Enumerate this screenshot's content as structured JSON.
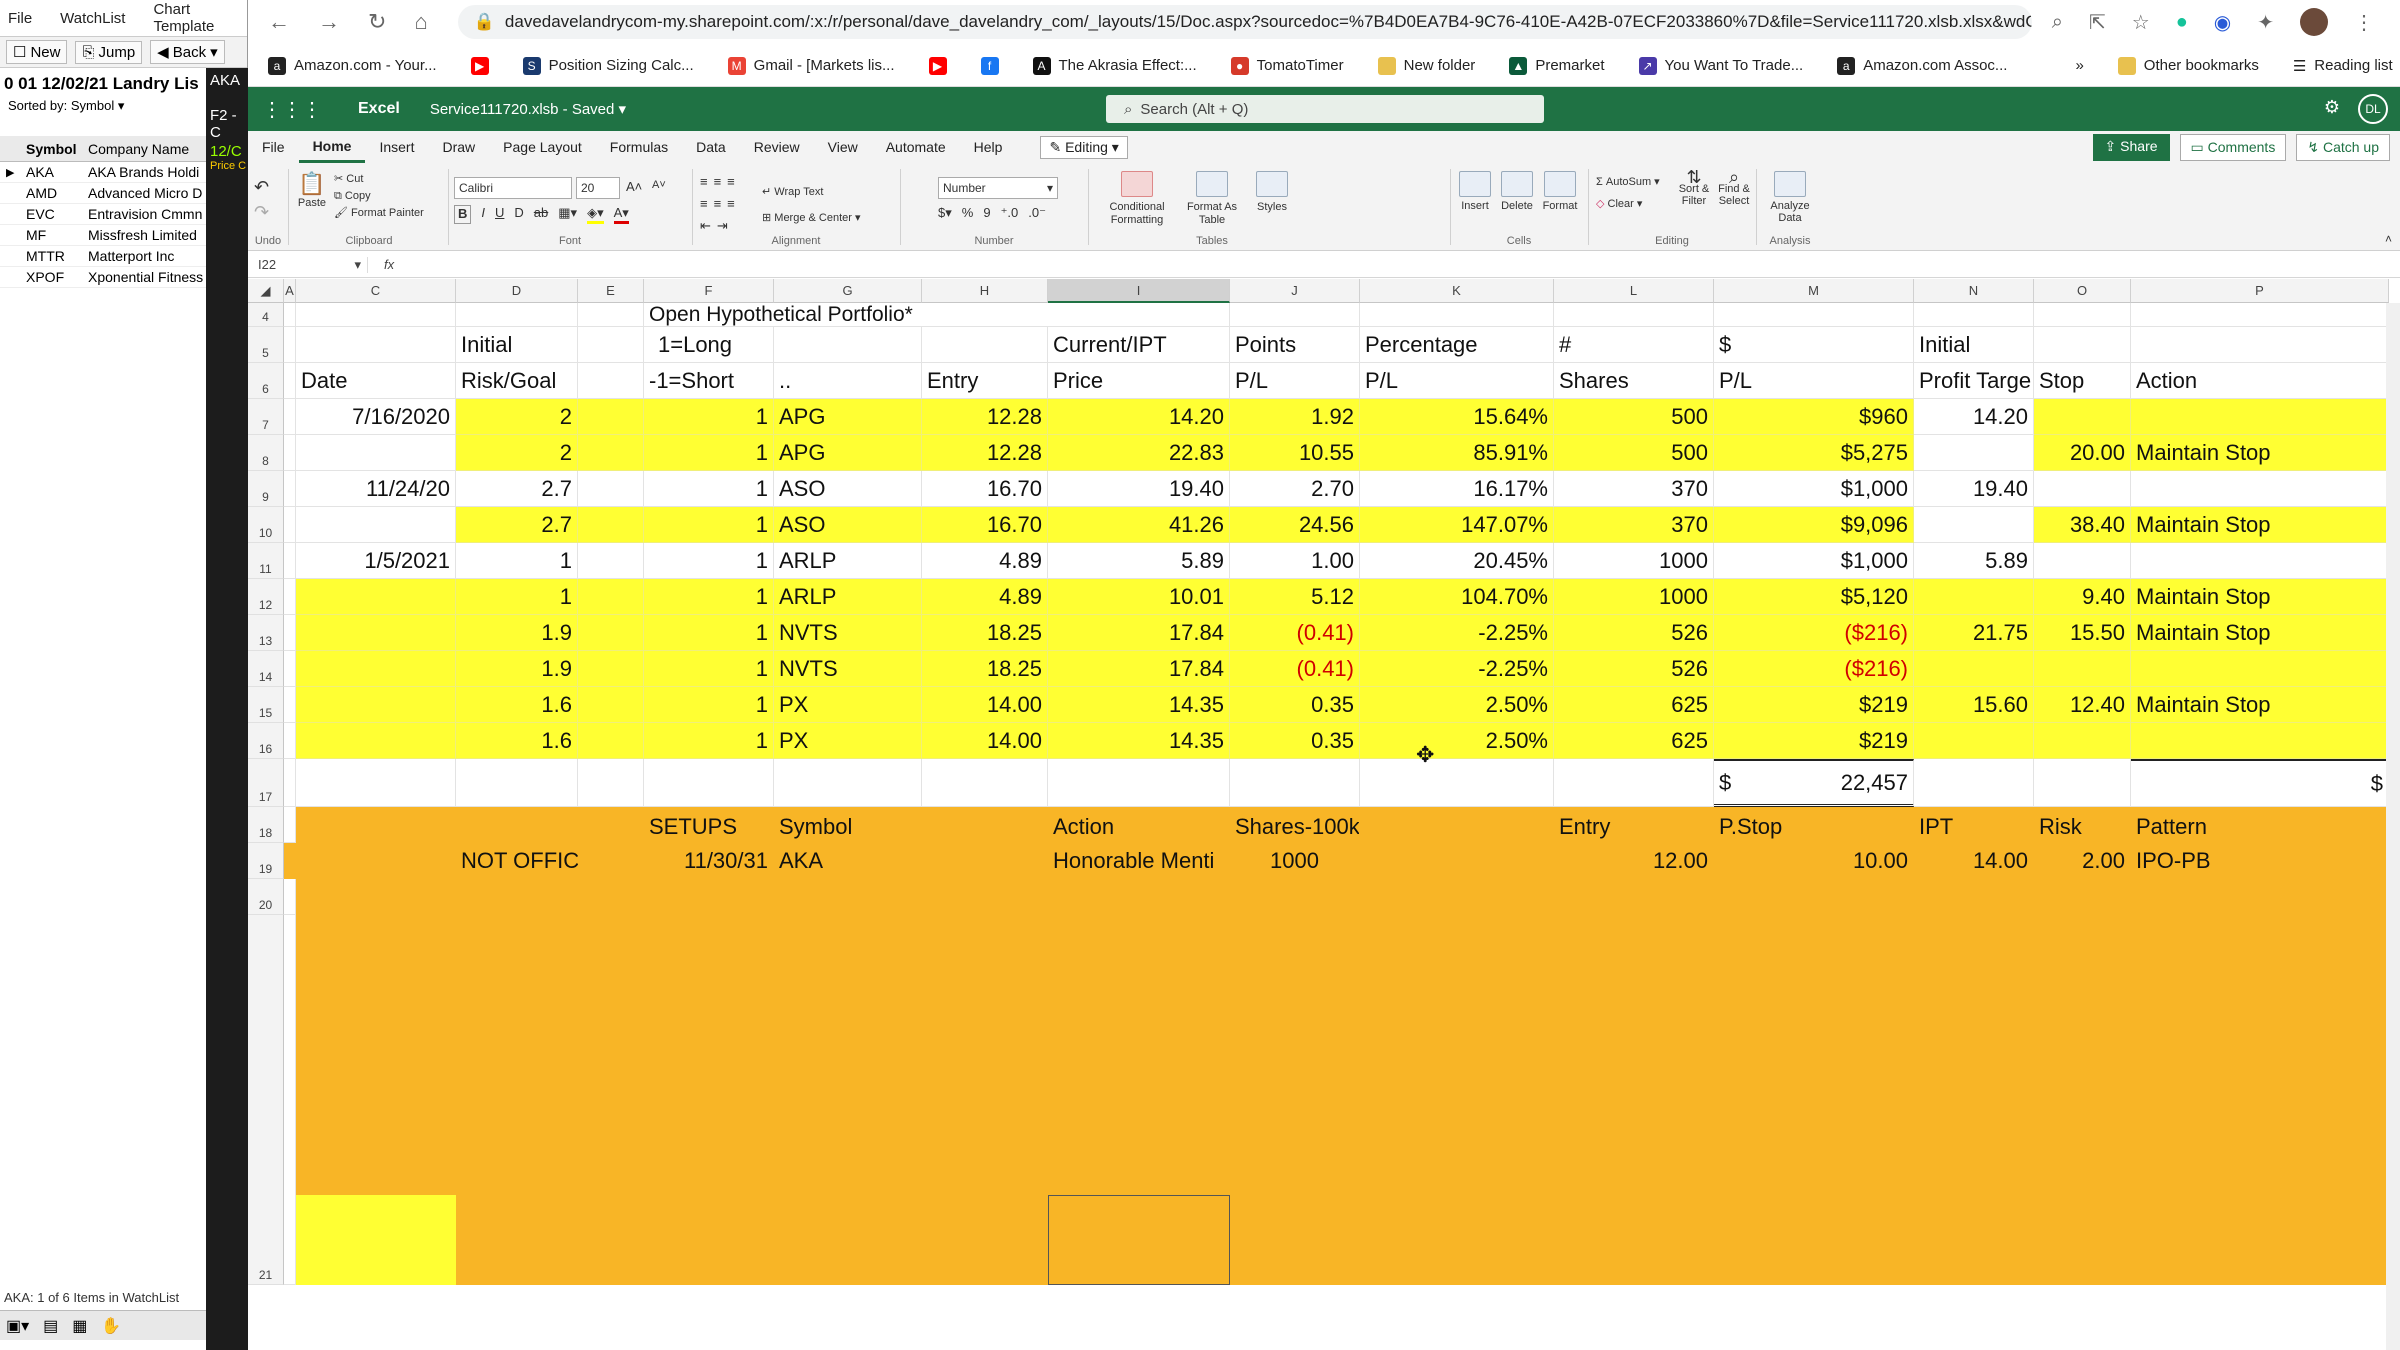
{
  "left_app": {
    "menu": [
      "File",
      "WatchList",
      "Chart Template"
    ],
    "toolbar": {
      "new": "New",
      "jump": "Jump",
      "back": "Back"
    },
    "watchlist_title": "0 01 12/02/21 Landry Lis",
    "sorted_by": "Sorted by: Symbol",
    "columns": [
      "Symbol",
      "Company Name"
    ],
    "rows": [
      {
        "symbol": "AKA",
        "name": "AKA Brands Holdi"
      },
      {
        "symbol": "AMD",
        "name": "Advanced Micro D"
      },
      {
        "symbol": "EVC",
        "name": "Entravision Cmmn"
      },
      {
        "symbol": "MF",
        "name": "Missfresh Limited"
      },
      {
        "symbol": "MTTR",
        "name": "Matterport Inc"
      },
      {
        "symbol": "XPOF",
        "name": "Xponential Fitness"
      }
    ],
    "status": "AKA: 1 of 6 Items in WatchList",
    "dark_strip": [
      "AKA",
      "F2 - C",
      "12/C",
      "Price C"
    ]
  },
  "chrome": {
    "url": "davedavelandrycom-my.sharepoint.com/:x:/r/personal/dave_davelandry_com/_layouts/15/Doc.aspx?sourcedoc=%7B4D0EA7B4-9C76-410E-A42B-07ECF2033860%7D&file=Service111720.xlsb.xlsx&wdOrigi...",
    "bookmarks": [
      {
        "label": "Amazon.com - Your...",
        "color": "#222222",
        "glyph": "a"
      },
      {
        "label": "",
        "color": "#ff0000",
        "glyph": "▶"
      },
      {
        "label": "Position Sizing Calc...",
        "color": "#1a3a6e",
        "glyph": "S"
      },
      {
        "label": "Gmail - [Markets lis...",
        "color": "#ea4335",
        "glyph": "M"
      },
      {
        "label": "",
        "color": "#ff0000",
        "glyph": "▶"
      },
      {
        "label": "",
        "color": "#1877f2",
        "glyph": "f"
      },
      {
        "label": "The Akrasia Effect:...",
        "color": "#111111",
        "glyph": "A"
      },
      {
        "label": "TomatoTimer",
        "color": "#d63a2a",
        "glyph": "●"
      },
      {
        "label": "New folder",
        "color": "#e8c14f",
        "glyph": ""
      },
      {
        "label": "Premarket",
        "color": "#0b5a3a",
        "glyph": "▲"
      },
      {
        "label": "You Want To Trade...",
        "color": "#4a3aa8",
        "glyph": "↗"
      },
      {
        "label": "Amazon.com Assoc...",
        "color": "#222222",
        "glyph": "a"
      }
    ],
    "more": "»",
    "other_bookmarks": "Other bookmarks",
    "reading_list": "Reading list"
  },
  "excel": {
    "app_name": "Excel",
    "file_name": "Service111720.xlsb - Saved",
    "search_placeholder": "Search (Alt + Q)",
    "user_initials": "DL",
    "tabs": [
      "File",
      "Home",
      "Insert",
      "Draw",
      "Page Layout",
      "Formulas",
      "Data",
      "Review",
      "View",
      "Automate",
      "Help"
    ],
    "editing": "Editing",
    "share": "Share",
    "comments": "Comments",
    "catch_up": "Catch up",
    "ribbon": {
      "undo": "Undo",
      "paste": "Paste",
      "cut": "Cut",
      "copy": "Copy",
      "format_painter": "Format Painter",
      "clipboard": "Clipboard",
      "font_name": "Calibri",
      "font_size": "20",
      "font": "Font",
      "wrap_text": "Wrap Text",
      "merge_center": "Merge & Center",
      "alignment": "Alignment",
      "number_format": "Number",
      "number": "Number",
      "conditional_formatting": "Conditional Formatting",
      "format_as_table": "Format As Table",
      "styles": "Styles",
      "tables": "Tables",
      "insert": "Insert",
      "delete": "Delete",
      "format": "Format",
      "cells": "Cells",
      "autosum": "AutoSum",
      "clear": "Clear",
      "sort_filter": "Sort & Filter",
      "find_select": "Find & Select",
      "editing_group": "Editing",
      "analyze_data": "Analyze Data",
      "analysis": "Analysis"
    },
    "name_box": "I22",
    "fx": "fx",
    "columns": [
      "A",
      "C",
      "D",
      "E",
      "F",
      "G",
      "H",
      "I",
      "J",
      "K",
      "L",
      "M",
      "N",
      "O",
      "P"
    ],
    "row_numbers": [
      "4",
      "5",
      "6",
      "7",
      "8",
      "9",
      "10",
      "11",
      "12",
      "13",
      "14",
      "15",
      "16",
      "17",
      "18",
      "19",
      "20",
      "21"
    ],
    "title_cell": "Open Hypothetical Portfolio*",
    "header_row1": {
      "d": "Initial",
      "f": "1=Long",
      "i": "Current/IPT",
      "j": "Points",
      "k": "Percentage",
      "l": "#",
      "m": "$",
      "n": "Initial"
    },
    "header_row2": {
      "c": "Date",
      "d": "Risk/Goal",
      "f": "-1=Short",
      "g": "..",
      "h": "Entry",
      "i": "Price",
      "j": "P/L",
      "k": "P/L",
      "l": "Shares",
      "m": "P/L",
      "n": "Profit Targe",
      "o": "Stop",
      "p": "Action"
    },
    "rows": [
      {
        "date": "7/16/2020",
        "risk": "2",
        "ls": "1",
        "sym": "APG",
        "entry": "12.28",
        "price": "14.20",
        "pts": "1.92",
        "pct": "15.64%",
        "shares": "500",
        "pl": "$960",
        "target": "14.20",
        "stop": "",
        "action": "",
        "highlight": "partial",
        "negative": false
      },
      {
        "date": "",
        "risk": "2",
        "ls": "1",
        "sym": "APG",
        "entry": "12.28",
        "price": "22.83",
        "pts": "10.55",
        "pct": "85.91%",
        "shares": "500",
        "pl": "$5,275",
        "target": "",
        "stop": "20.00",
        "action": "Maintain Stop",
        "highlight": "partial",
        "negative": false
      },
      {
        "date": "11/24/20",
        "risk": "2.7",
        "ls": "1",
        "sym": "ASO",
        "entry": "16.70",
        "price": "19.40",
        "pts": "2.70",
        "pct": "16.17%",
        "shares": "370",
        "pl": "$1,000",
        "target": "19.40",
        "stop": "",
        "action": "",
        "highlight": "none",
        "negative": false
      },
      {
        "date": "",
        "risk": "2.7",
        "ls": "1",
        "sym": "ASO",
        "entry": "16.70",
        "price": "41.26",
        "pts": "24.56",
        "pct": "147.07%",
        "shares": "370",
        "pl": "$9,096",
        "target": "",
        "stop": "38.40",
        "action": "Maintain Stop",
        "highlight": "partial",
        "negative": false
      },
      {
        "date": "1/5/2021",
        "risk": "1",
        "ls": "1",
        "sym": "ARLP",
        "entry": "4.89",
        "price": "5.89",
        "pts": "1.00",
        "pct": "20.45%",
        "shares": "1000",
        "pl": "$1,000",
        "target": "5.89",
        "stop": "",
        "action": "",
        "highlight": "none",
        "negative": false
      },
      {
        "date": "",
        "risk": "1",
        "ls": "1",
        "sym": "ARLP",
        "entry": "4.89",
        "price": "10.01",
        "pts": "5.12",
        "pct": "104.70%",
        "shares": "1000",
        "pl": "$5,120",
        "target": "",
        "stop": "9.40",
        "action": "Maintain Stop",
        "highlight": "full",
        "negative": false
      },
      {
        "date": "",
        "risk": "1.9",
        "ls": "1",
        "sym": "NVTS",
        "entry": "18.25",
        "price": "17.84",
        "pts": "(0.41)",
        "pct": "-2.25%",
        "shares": "526",
        "pl": "($216)",
        "target": "21.75",
        "stop": "15.50",
        "action": "Maintain Stop",
        "highlight": "full",
        "negative": true
      },
      {
        "date": "",
        "risk": "1.9",
        "ls": "1",
        "sym": "NVTS",
        "entry": "18.25",
        "price": "17.84",
        "pts": "(0.41)",
        "pct": "-2.25%",
        "shares": "526",
        "pl": "($216)",
        "target": "",
        "stop": "",
        "action": "",
        "highlight": "full",
        "negative": true
      },
      {
        "date": "",
        "risk": "1.6",
        "ls": "1",
        "sym": "PX",
        "entry": "14.00",
        "price": "14.35",
        "pts": "0.35",
        "pct": "2.50%",
        "shares": "625",
        "pl": "$219",
        "target": "15.60",
        "stop": "12.40",
        "action": "Maintain Stop",
        "highlight": "full",
        "negative": false
      },
      {
        "date": "",
        "risk": "1.6",
        "ls": "1",
        "sym": "PX",
        "entry": "14.00",
        "price": "14.35",
        "pts": "0.35",
        "pct": "2.50%",
        "shares": "625",
        "pl": "$219",
        "target": "",
        "stop": "",
        "action": "",
        "highlight": "full",
        "negative": false
      }
    ],
    "total": {
      "currency": "$",
      "value": "22,457",
      "p_currency": "$"
    },
    "setups_header": {
      "f": "SETUPS",
      "g": "Symbol",
      "i": "Action",
      "j": "Shares-100k",
      "l": "Entry",
      "m": "P.Stop",
      "n": "IPT",
      "o": "Risk",
      "p": "Pattern"
    },
    "setup_row": {
      "d": "NOT OFFICIAL",
      "f": "11/30/31",
      "g": "AKA",
      "i": "Honorable Menti",
      "j": "1000",
      "l": "12.00",
      "m": "10.00",
      "n": "14.00",
      "o": "2.00",
      "p": "IPO-PB"
    },
    "colors": {
      "yellow": "#ffff33",
      "orange": "#f8b526",
      "excel_green": "#1f7244",
      "negative_red": "#d00000"
    }
  }
}
